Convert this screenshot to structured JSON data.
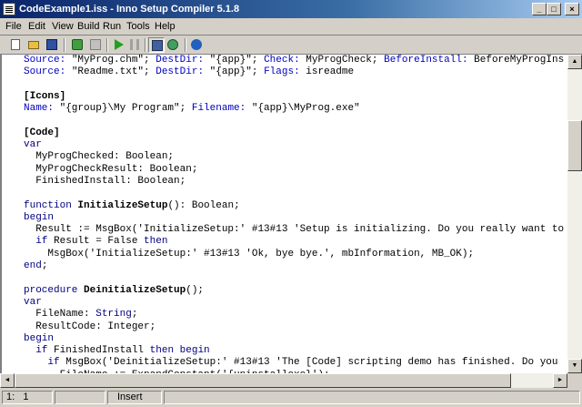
{
  "window": {
    "title": "CodeExample1.iss - Inno Setup Compiler 5.1.8",
    "minimize_glyph": "_",
    "maximize_glyph": "□",
    "close_glyph": "×"
  },
  "menu": [
    "File",
    "Edit",
    "View",
    "Build",
    "Run",
    "Tools",
    "Help"
  ],
  "toolbar": [
    {
      "name": "new-file-icon",
      "color": "#ffffff"
    },
    {
      "name": "open-folder-icon",
      "color": "#e8c040"
    },
    {
      "name": "save-icon",
      "color": "#3050a0"
    },
    {
      "name": "compile-icon",
      "color": "#40a040"
    },
    {
      "name": "stop-compile-icon",
      "color": "#c04040"
    },
    {
      "name": "run-icon",
      "color": "#20a020"
    },
    {
      "name": "pause-icon",
      "color": "#a0a0a0"
    },
    {
      "name": "target-setup-icon",
      "color": "#4060a0"
    },
    {
      "name": "target-uninstall-icon",
      "color": "#40a060"
    },
    {
      "name": "help-icon",
      "color": "#2060c0"
    }
  ],
  "editor": {
    "lines": [
      [
        [
          "Source: ",
          "k"
        ],
        [
          "\"MyProg.chm\"; ",
          ""
        ],
        [
          "DestDir: ",
          "k"
        ],
        [
          "\"{app}\"; ",
          ""
        ],
        [
          "Check: ",
          "k"
        ],
        [
          "MyProgCheck; ",
          ""
        ],
        [
          "BeforeInstall: ",
          "k"
        ],
        [
          "BeforeMyProgIns",
          ""
        ]
      ],
      [
        [
          "Source: ",
          "k"
        ],
        [
          "\"Readme.txt\"; ",
          ""
        ],
        [
          "DestDir: ",
          "k"
        ],
        [
          "\"{app}\"; ",
          ""
        ],
        [
          "Flags: ",
          "k"
        ],
        [
          "isreadme",
          ""
        ]
      ],
      [],
      [
        [
          "[Icons]",
          "b"
        ]
      ],
      [
        [
          "Name: ",
          "k"
        ],
        [
          "\"{group}\\My Program\"; ",
          ""
        ],
        [
          "Filename: ",
          "k"
        ],
        [
          "\"{app}\\MyProg.exe\"",
          ""
        ]
      ],
      [],
      [
        [
          "[Code]",
          "b"
        ]
      ],
      [
        [
          "var",
          "kw"
        ]
      ],
      [
        [
          "  MyProgChecked: Boolean;",
          ""
        ]
      ],
      [
        [
          "  MyProgCheckResult: Boolean;",
          ""
        ]
      ],
      [
        [
          "  FinishedInstall: Boolean;",
          ""
        ]
      ],
      [],
      [
        [
          "function ",
          "kw"
        ],
        [
          "InitializeSetup",
          "b"
        ],
        [
          "(): Boolean;",
          ""
        ]
      ],
      [
        [
          "begin",
          "kw"
        ]
      ],
      [
        [
          "  Result := MsgBox('InitializeSetup:' #13#13 'Setup is initializing. Do you really want to",
          ""
        ]
      ],
      [
        [
          "  ",
          ""
        ],
        [
          "if ",
          "kw"
        ],
        [
          "Result = False ",
          ""
        ],
        [
          "then",
          "kw"
        ]
      ],
      [
        [
          "    MsgBox('InitializeSetup:' #13#13 'Ok, bye bye.', mbInformation, MB_OK);",
          ""
        ]
      ],
      [
        [
          "end",
          "kw"
        ],
        [
          ";",
          ""
        ]
      ],
      [],
      [
        [
          "procedure ",
          "kw"
        ],
        [
          "DeinitializeSetup",
          "b"
        ],
        [
          "();",
          ""
        ]
      ],
      [
        [
          "var",
          "kw"
        ]
      ],
      [
        [
          "  FileName: ",
          ""
        ],
        [
          "String",
          "kw"
        ],
        [
          ";",
          ""
        ]
      ],
      [
        [
          "  ResultCode: Integer;",
          ""
        ]
      ],
      [
        [
          "begin",
          "kw"
        ]
      ],
      [
        [
          "  ",
          ""
        ],
        [
          "if ",
          "kw"
        ],
        [
          "FinishedInstall ",
          ""
        ],
        [
          "then begin",
          "kw"
        ]
      ],
      [
        [
          "    ",
          ""
        ],
        [
          "if ",
          "kw"
        ],
        [
          "MsgBox('DeinitializeSetup:' #13#13 'The [Code] scripting demo has finished. Do you",
          ""
        ]
      ],
      [
        [
          "      FileName := ExpandConstant('{uninstallexe}');",
          ""
        ]
      ]
    ]
  },
  "scrollbars": {
    "up_glyph": "▲",
    "down_glyph": "▼",
    "left_glyph": "◄",
    "right_glyph": "►"
  },
  "status": {
    "position": "1:   1",
    "panel2": "",
    "mode": "Insert"
  }
}
